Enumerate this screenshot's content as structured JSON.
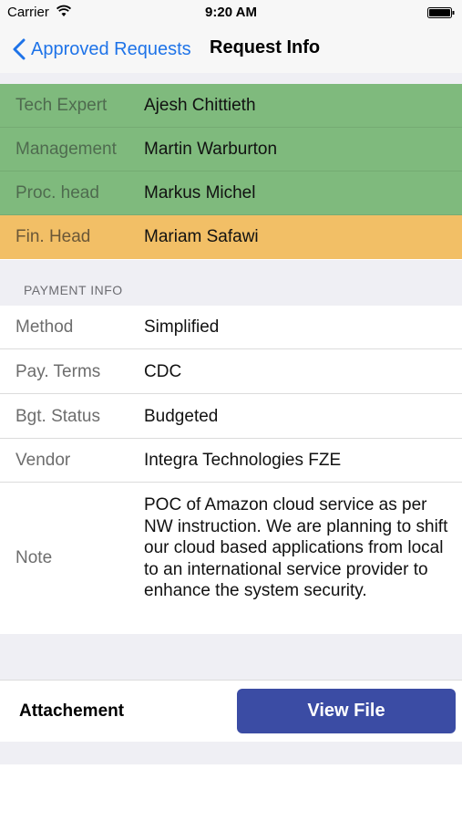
{
  "status_bar": {
    "carrier": "Carrier",
    "time": "9:20 AM"
  },
  "nav": {
    "back_label": "Approved Requests",
    "title": "Request Info"
  },
  "approvals": [
    {
      "role": "Tech Expert",
      "name": "Ajesh Chittieth",
      "status_color": "#7fba7d"
    },
    {
      "role": "Management",
      "name": "Martin Warburton",
      "status_color": "#7fba7d"
    },
    {
      "role": "Proc. head",
      "name": "Markus Michel",
      "status_color": "#7fba7d"
    },
    {
      "role": "Fin. Head",
      "name": "Mariam Safawi",
      "status_color": "#f2bf66"
    }
  ],
  "payment": {
    "section_title": "PAYMENT INFO",
    "rows": [
      {
        "label": "Method",
        "value": "Simplified"
      },
      {
        "label": "Pay. Terms",
        "value": "CDC"
      },
      {
        "label": "Bgt. Status",
        "value": "Budgeted"
      },
      {
        "label": "Vendor",
        "value": "Integra Technologies FZE"
      }
    ],
    "note_label": "Note",
    "note_text": "POC of Amazon cloud service as per NW instruction. We are planning to shift our cloud based applications from local to an international service provider to enhance the system security."
  },
  "attachment": {
    "label": "Attachement",
    "button_label": "View File"
  },
  "colors": {
    "accent": "#1e73e8",
    "button": "#3b4ca4",
    "approved": "#7fba7d",
    "pending": "#f2bf66"
  }
}
